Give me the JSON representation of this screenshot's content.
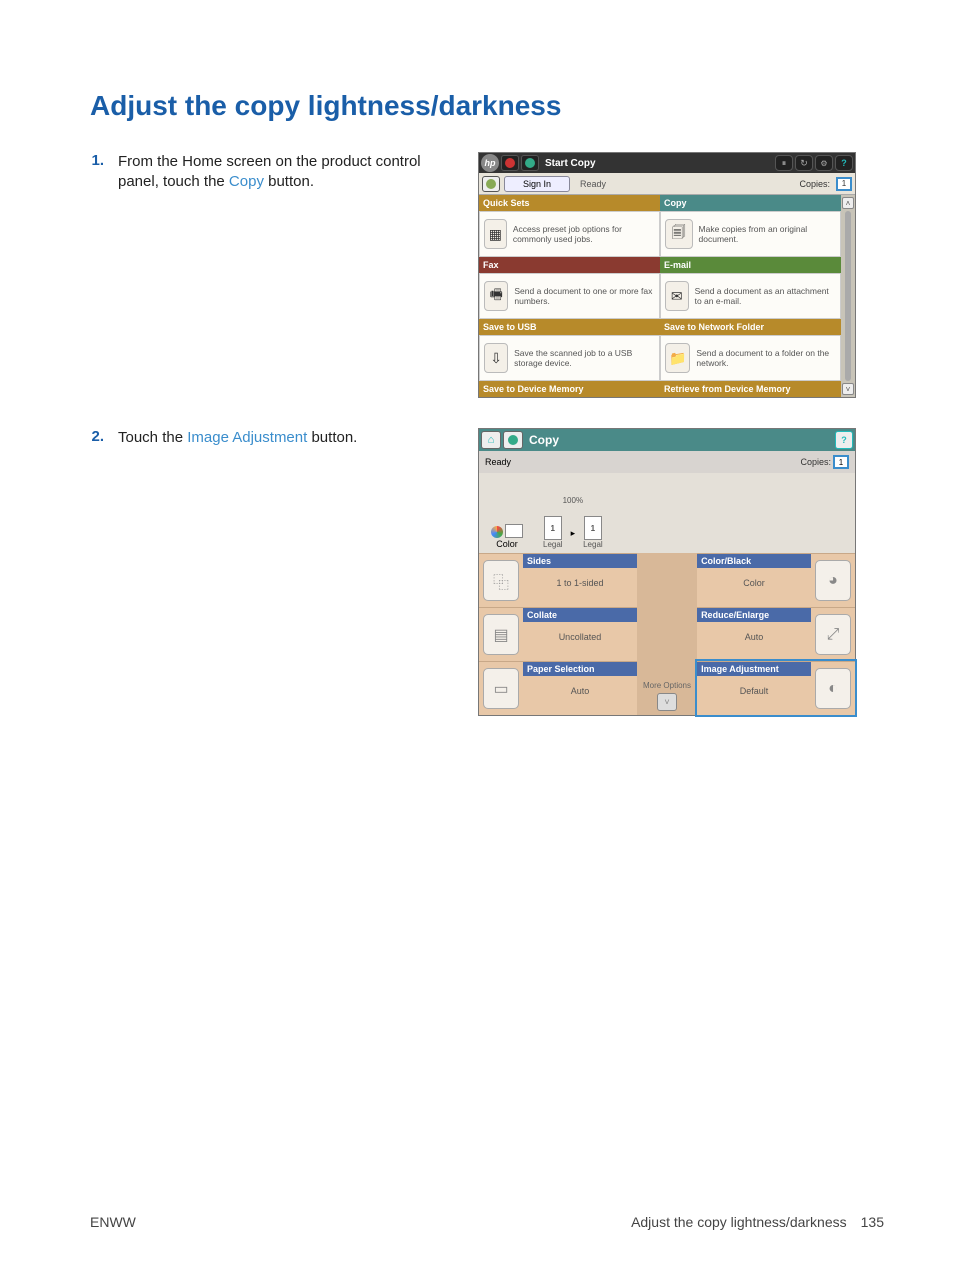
{
  "page_title": "Adjust the copy lightness/darkness",
  "steps": [
    {
      "num": "1.",
      "pre": "From the Home screen on the product control panel, touch the ",
      "link": "Copy",
      "post": " button."
    },
    {
      "num": "2.",
      "pre": "Touch the ",
      "link": "Image Adjustment",
      "post": " button."
    }
  ],
  "s1": {
    "start_copy": "Start Copy",
    "sign_in": "Sign In",
    "ready": "Ready",
    "copies": "Copies:",
    "copies_val": "1",
    "tiles": [
      {
        "hdr": "Quick Sets",
        "cls": "hdr-gold",
        "desc": "Access preset job options for commonly used jobs."
      },
      {
        "hdr": "Copy",
        "cls": "hdr-teal",
        "desc": "Make copies from an original document."
      },
      {
        "hdr": "Fax",
        "cls": "hdr-red",
        "desc": "Send a document to one or more fax numbers."
      },
      {
        "hdr": "E-mail",
        "cls": "hdr-green",
        "desc": "Send a document as an attachment to an e-mail."
      },
      {
        "hdr": "Save to USB",
        "cls": "hdr-gold",
        "desc": "Save the scanned job to a USB storage device."
      },
      {
        "hdr": "Save to Network Folder",
        "cls": "hdr-gold",
        "desc": "Send a document to a folder on the network."
      },
      {
        "hdr": "Save to Device Memory",
        "cls": "hdr-gold"
      },
      {
        "hdr": "Retrieve from Device Memory",
        "cls": "hdr-gold"
      }
    ]
  },
  "s2": {
    "title": "Copy",
    "ready": "Ready",
    "copies": "Copies:",
    "copies_val": "1",
    "color": "Color",
    "percent": "100%",
    "legal": "Legal",
    "page": "1",
    "more": "More Options",
    "opts_l": [
      {
        "title": "Sides",
        "val": "1 to 1-sided"
      },
      {
        "title": "Collate",
        "val": "Uncollated"
      },
      {
        "title": "Paper Selection",
        "val": "Auto"
      }
    ],
    "opts_r": [
      {
        "title": "Color/Black",
        "val": "Color"
      },
      {
        "title": "Reduce/Enlarge",
        "val": "Auto"
      },
      {
        "title": "Image Adjustment",
        "val": "Default"
      }
    ]
  },
  "footer": {
    "left": "ENWW",
    "right": "Adjust the copy lightness/darkness",
    "page": "135"
  }
}
